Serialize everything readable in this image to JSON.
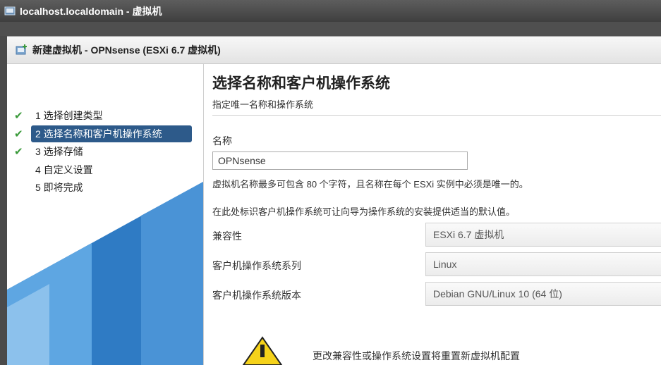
{
  "window": {
    "title": "localhost.localdomain - 虚拟机"
  },
  "dialog": {
    "title": "新建虚拟机 - OPNsense (ESXi 6.7 虚拟机)"
  },
  "steps": [
    {
      "label": "1 选择创建类型",
      "done": true,
      "active": false
    },
    {
      "label": "2 选择名称和客户机操作系统",
      "done": true,
      "active": true
    },
    {
      "label": "3 选择存储",
      "done": true,
      "active": false
    },
    {
      "label": "4 自定义设置",
      "done": false,
      "active": false
    },
    {
      "label": "5 即将完成",
      "done": false,
      "active": false
    }
  ],
  "main": {
    "heading": "选择名称和客户机操作系统",
    "subheading": "指定唯一名称和操作系统",
    "name_label": "名称",
    "name_value": "OPNsense",
    "name_hint": "虚拟机名称最多可包含 80 个字符，且名称在每个 ESXi 实例中必须是唯一的。",
    "os_hint": "在此处标识客户机操作系统可让向导为操作系统的安装提供适当的默认值。",
    "fields": [
      {
        "label": "兼容性",
        "value": "ESXi 6.7 虚拟机"
      },
      {
        "label": "客户机操作系统系列",
        "value": "Linux"
      },
      {
        "label": "客户机操作系统版本",
        "value": "Debian GNU/Linux 10 (64 位)"
      }
    ],
    "warning": "更改兼容性或操作系统设置将重置新虚拟机配置"
  },
  "colors": {
    "accent": "#2d5a8a",
    "check": "#3a9a3a",
    "art_blue": "#2f7bc4"
  },
  "icons": {
    "window": "vm-icon",
    "dialog": "new-vm-icon",
    "check": "checkmark-icon",
    "warning": "warning-icon"
  }
}
